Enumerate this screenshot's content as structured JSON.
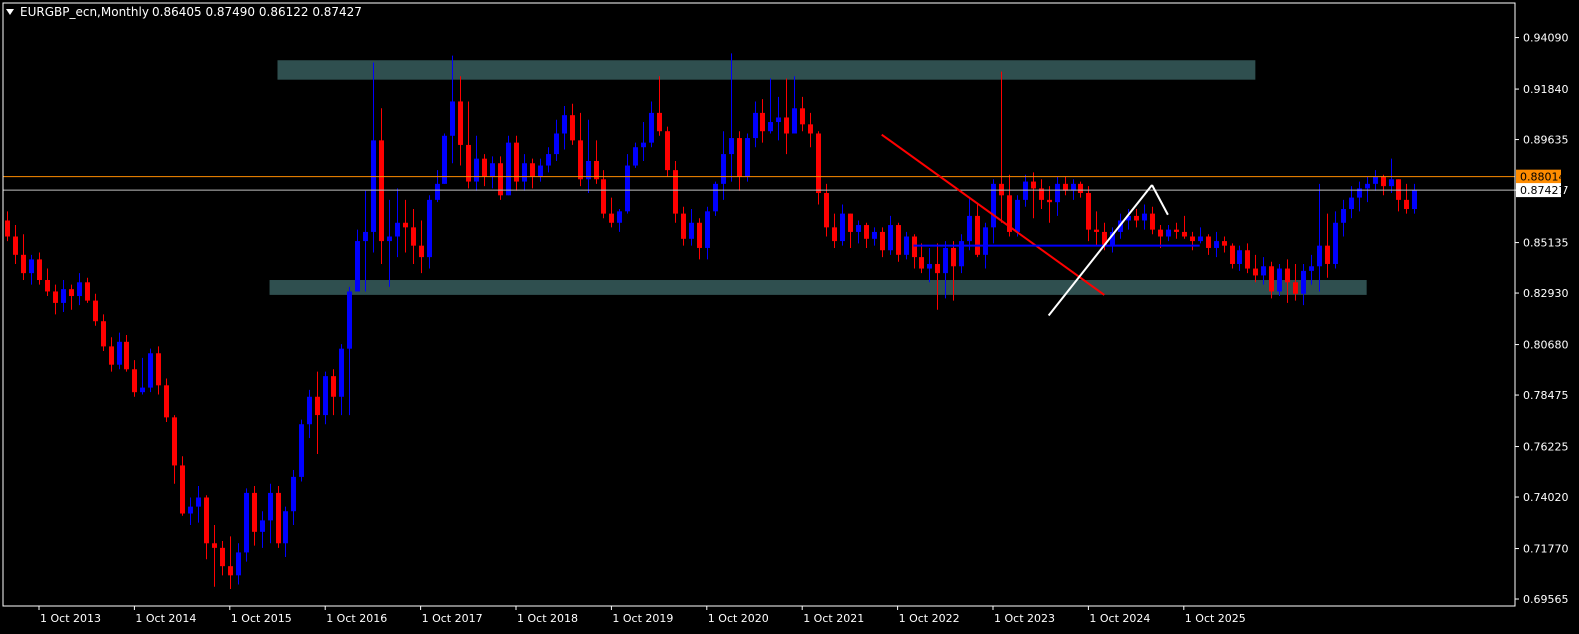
{
  "window": {
    "symbol_title": "EURGBP_ecn,Monthly",
    "ohlc_text": "0.86405 0.87490 0.86122 0.87427",
    "menu_icon": "triangle-down-icon"
  },
  "colors": {
    "background": "#000000",
    "frame": "#ffffff",
    "bull_candle": "#0000ff",
    "bear_candle": "#ff0000",
    "zone_fill": "#2f4f4f",
    "orange_line": "#ff8c00",
    "current_price_line": "#c0c0c0",
    "trendline_red": "#ff0000",
    "support_line_blue": "#0000ff",
    "swing_line_white": "#ffffff"
  },
  "chart_data": {
    "type": "candlestick",
    "timeframe": "Monthly",
    "x_tick_labels": [
      "1 Oct 2013",
      "1 Oct 2014",
      "1 Oct 2015",
      "1 Oct 2016",
      "1 Oct 2017",
      "1 Oct 2018",
      "1 Oct 2019",
      "1 Oct 2020",
      "1 Oct 2021",
      "1 Oct 2022",
      "1 Oct 2023",
      "1 Oct 2024",
      "1 Oct 2025"
    ],
    "y_ticks": [
      0.9409,
      0.9184,
      0.89635,
      0.87427,
      0.85135,
      0.8293,
      0.8068,
      0.78475,
      0.76225,
      0.7402,
      0.7177,
      0.69565
    ],
    "y_tick_labels": [
      "0.94090",
      "0.91840",
      "0.89635",
      "0.87427",
      "0.85135",
      "0.82930",
      "0.80680",
      "0.78475",
      "0.76225",
      "0.74020",
      "0.71770",
      "0.69565"
    ],
    "ylim": [
      0.6926,
      0.956
    ],
    "x_start": "2013-06",
    "candles": [
      [
        0.861,
        0.865,
        0.852,
        0.854
      ],
      [
        0.854,
        0.859,
        0.842,
        0.846
      ],
      [
        0.846,
        0.855,
        0.835,
        0.838
      ],
      [
        0.838,
        0.846,
        0.833,
        0.844
      ],
      [
        0.844,
        0.847,
        0.833,
        0.835
      ],
      [
        0.835,
        0.84,
        0.828,
        0.83
      ],
      [
        0.83,
        0.833,
        0.82,
        0.825
      ],
      [
        0.825,
        0.835,
        0.821,
        0.831
      ],
      [
        0.831,
        0.833,
        0.822,
        0.828
      ],
      [
        0.828,
        0.838,
        0.824,
        0.834
      ],
      [
        0.834,
        0.836,
        0.825,
        0.826
      ],
      [
        0.826,
        0.829,
        0.815,
        0.817
      ],
      [
        0.817,
        0.82,
        0.804,
        0.806
      ],
      [
        0.806,
        0.81,
        0.795,
        0.798
      ],
      [
        0.798,
        0.812,
        0.796,
        0.808
      ],
      [
        0.808,
        0.811,
        0.795,
        0.796
      ],
      [
        0.796,
        0.8,
        0.784,
        0.786
      ],
      [
        0.786,
        0.801,
        0.785,
        0.788
      ],
      [
        0.788,
        0.805,
        0.786,
        0.803
      ],
      [
        0.803,
        0.806,
        0.785,
        0.789
      ],
      [
        0.789,
        0.792,
        0.773,
        0.775
      ],
      [
        0.775,
        0.776,
        0.746,
        0.754
      ],
      [
        0.754,
        0.758,
        0.732,
        0.733
      ],
      [
        0.733,
        0.74,
        0.728,
        0.736
      ],
      [
        0.736,
        0.745,
        0.729,
        0.74
      ],
      [
        0.74,
        0.741,
        0.713,
        0.72
      ],
      [
        0.72,
        0.728,
        0.701,
        0.718
      ],
      [
        0.718,
        0.721,
        0.706,
        0.71
      ],
      [
        0.71,
        0.723,
        0.7,
        0.706
      ],
      [
        0.706,
        0.72,
        0.702,
        0.716
      ],
      [
        0.716,
        0.744,
        0.712,
        0.742
      ],
      [
        0.742,
        0.745,
        0.719,
        0.725
      ],
      [
        0.725,
        0.734,
        0.718,
        0.73
      ],
      [
        0.73,
        0.746,
        0.72,
        0.742
      ],
      [
        0.742,
        0.745,
        0.718,
        0.72
      ],
      [
        0.72,
        0.736,
        0.714,
        0.734
      ],
      [
        0.734,
        0.752,
        0.728,
        0.749
      ],
      [
        0.749,
        0.774,
        0.747,
        0.772
      ],
      [
        0.772,
        0.787,
        0.766,
        0.784
      ],
      [
        0.784,
        0.795,
        0.759,
        0.776
      ],
      [
        0.776,
        0.795,
        0.772,
        0.793
      ],
      [
        0.793,
        0.796,
        0.776,
        0.784
      ],
      [
        0.784,
        0.807,
        0.776,
        0.805
      ],
      [
        0.805,
        0.832,
        0.776,
        0.83
      ],
      [
        0.83,
        0.857,
        0.83,
        0.852
      ],
      [
        0.852,
        0.874,
        0.83,
        0.856
      ],
      [
        0.856,
        0.93,
        0.847,
        0.896
      ],
      [
        0.896,
        0.91,
        0.842,
        0.852
      ],
      [
        0.852,
        0.87,
        0.832,
        0.854
      ],
      [
        0.854,
        0.875,
        0.845,
        0.86
      ],
      [
        0.86,
        0.87,
        0.847,
        0.858
      ],
      [
        0.858,
        0.866,
        0.842,
        0.85
      ],
      [
        0.85,
        0.861,
        0.838,
        0.845
      ],
      [
        0.845,
        0.872,
        0.84,
        0.87
      ],
      [
        0.87,
        0.883,
        0.869,
        0.877
      ],
      [
        0.877,
        0.899,
        0.877,
        0.898
      ],
      [
        0.898,
        0.933,
        0.886,
        0.913
      ],
      [
        0.913,
        0.924,
        0.885,
        0.894
      ],
      [
        0.894,
        0.913,
        0.875,
        0.878
      ],
      [
        0.878,
        0.898,
        0.874,
        0.888
      ],
      [
        0.888,
        0.89,
        0.876,
        0.88
      ],
      [
        0.88,
        0.889,
        0.875,
        0.886
      ],
      [
        0.886,
        0.889,
        0.87,
        0.872
      ],
      [
        0.872,
        0.898,
        0.872,
        0.895
      ],
      [
        0.895,
        0.898,
        0.874,
        0.878
      ],
      [
        0.878,
        0.89,
        0.874,
        0.886
      ],
      [
        0.886,
        0.888,
        0.875,
        0.88
      ],
      [
        0.88,
        0.888,
        0.878,
        0.885
      ],
      [
        0.885,
        0.893,
        0.882,
        0.89
      ],
      [
        0.89,
        0.905,
        0.887,
        0.899
      ],
      [
        0.899,
        0.911,
        0.892,
        0.907
      ],
      [
        0.907,
        0.912,
        0.894,
        0.896
      ],
      [
        0.896,
        0.908,
        0.876,
        0.879
      ],
      [
        0.879,
        0.905,
        0.873,
        0.887
      ],
      [
        0.887,
        0.896,
        0.877,
        0.879
      ],
      [
        0.879,
        0.883,
        0.862,
        0.864
      ],
      [
        0.864,
        0.871,
        0.858,
        0.86
      ],
      [
        0.86,
        0.866,
        0.856,
        0.865
      ],
      [
        0.865,
        0.89,
        0.864,
        0.885
      ],
      [
        0.885,
        0.895,
        0.884,
        0.893
      ],
      [
        0.893,
        0.904,
        0.887,
        0.895
      ],
      [
        0.895,
        0.913,
        0.893,
        0.908
      ],
      [
        0.908,
        0.924,
        0.898,
        0.9
      ],
      [
        0.9,
        0.902,
        0.88,
        0.883
      ],
      [
        0.883,
        0.887,
        0.86,
        0.864
      ],
      [
        0.864,
        0.867,
        0.85,
        0.853
      ],
      [
        0.853,
        0.866,
        0.85,
        0.86
      ],
      [
        0.86,
        0.862,
        0.844,
        0.849
      ],
      [
        0.849,
        0.867,
        0.844,
        0.865
      ],
      [
        0.865,
        0.878,
        0.863,
        0.877
      ],
      [
        0.877,
        0.9,
        0.87,
        0.89
      ],
      [
        0.89,
        0.934,
        0.878,
        0.897
      ],
      [
        0.897,
        0.9,
        0.874,
        0.88
      ],
      [
        0.88,
        0.899,
        0.878,
        0.897
      ],
      [
        0.897,
        0.913,
        0.893,
        0.908
      ],
      [
        0.908,
        0.914,
        0.895,
        0.9
      ],
      [
        0.9,
        0.923,
        0.899,
        0.904
      ],
      [
        0.904,
        0.915,
        0.896,
        0.906
      ],
      [
        0.906,
        0.923,
        0.89,
        0.899
      ],
      [
        0.899,
        0.924,
        0.899,
        0.91
      ],
      [
        0.91,
        0.915,
        0.9,
        0.903
      ],
      [
        0.903,
        0.908,
        0.893,
        0.899
      ],
      [
        0.899,
        0.9,
        0.868,
        0.873
      ],
      [
        0.873,
        0.877,
        0.854,
        0.858
      ],
      [
        0.858,
        0.864,
        0.849,
        0.852
      ],
      [
        0.852,
        0.868,
        0.85,
        0.864
      ],
      [
        0.864,
        0.864,
        0.849,
        0.856
      ],
      [
        0.856,
        0.861,
        0.851,
        0.859
      ],
      [
        0.859,
        0.86,
        0.849,
        0.853
      ],
      [
        0.853,
        0.858,
        0.85,
        0.856
      ],
      [
        0.856,
        0.858,
        0.845,
        0.848
      ],
      [
        0.848,
        0.863,
        0.846,
        0.859
      ],
      [
        0.859,
        0.86,
        0.843,
        0.846
      ],
      [
        0.846,
        0.856,
        0.844,
        0.854
      ],
      [
        0.854,
        0.855,
        0.84,
        0.845
      ],
      [
        0.845,
        0.851,
        0.838,
        0.84
      ],
      [
        0.84,
        0.849,
        0.834,
        0.842
      ],
      [
        0.842,
        0.851,
        0.822,
        0.838
      ],
      [
        0.838,
        0.852,
        0.827,
        0.849
      ],
      [
        0.849,
        0.852,
        0.826,
        0.841
      ],
      [
        0.841,
        0.855,
        0.838,
        0.852
      ],
      [
        0.852,
        0.871,
        0.848,
        0.863
      ],
      [
        0.863,
        0.868,
        0.845,
        0.846
      ],
      [
        0.846,
        0.86,
        0.84,
        0.858
      ],
      [
        0.858,
        0.879,
        0.851,
        0.877
      ],
      [
        0.877,
        0.926,
        0.86,
        0.872
      ],
      [
        0.872,
        0.881,
        0.854,
        0.856
      ],
      [
        0.856,
        0.872,
        0.854,
        0.87
      ],
      [
        0.87,
        0.881,
        0.867,
        0.878
      ],
      [
        0.878,
        0.882,
        0.862,
        0.875
      ],
      [
        0.875,
        0.879,
        0.866,
        0.87
      ],
      [
        0.87,
        0.876,
        0.86,
        0.869
      ],
      [
        0.869,
        0.88,
        0.863,
        0.877
      ],
      [
        0.877,
        0.88,
        0.872,
        0.874
      ],
      [
        0.874,
        0.879,
        0.87,
        0.877
      ],
      [
        0.877,
        0.878,
        0.871,
        0.873
      ],
      [
        0.873,
        0.876,
        0.852,
        0.857
      ],
      [
        0.857,
        0.865,
        0.85,
        0.856
      ],
      [
        0.856,
        0.86,
        0.848,
        0.85
      ],
      [
        0.85,
        0.858,
        0.847,
        0.856
      ],
      [
        0.856,
        0.864,
        0.853,
        0.861
      ],
      [
        0.861,
        0.866,
        0.857,
        0.863
      ],
      [
        0.863,
        0.866,
        0.858,
        0.861
      ],
      [
        0.861,
        0.868,
        0.857,
        0.864
      ],
      [
        0.864,
        0.867,
        0.855,
        0.857
      ],
      [
        0.857,
        0.859,
        0.849,
        0.854
      ],
      [
        0.854,
        0.859,
        0.852,
        0.857
      ],
      [
        0.857,
        0.86,
        0.853,
        0.856
      ],
      [
        0.856,
        0.863,
        0.853,
        0.854
      ],
      [
        0.854,
        0.856,
        0.848,
        0.852
      ],
      [
        0.852,
        0.858,
        0.851,
        0.854
      ],
      [
        0.854,
        0.855,
        0.846,
        0.849
      ],
      [
        0.849,
        0.856,
        0.845,
        0.852
      ],
      [
        0.852,
        0.854,
        0.847,
        0.85
      ],
      [
        0.85,
        0.851,
        0.84,
        0.842
      ],
      [
        0.842,
        0.85,
        0.839,
        0.848
      ],
      [
        0.848,
        0.851,
        0.838,
        0.84
      ],
      [
        0.84,
        0.846,
        0.834,
        0.837
      ],
      [
        0.837,
        0.845,
        0.833,
        0.841
      ],
      [
        0.841,
        0.843,
        0.827,
        0.83
      ],
      [
        0.83,
        0.842,
        0.828,
        0.84
      ],
      [
        0.84,
        0.844,
        0.825,
        0.834
      ],
      [
        0.834,
        0.842,
        0.826,
        0.829
      ],
      [
        0.829,
        0.842,
        0.824,
        0.839
      ],
      [
        0.839,
        0.846,
        0.833,
        0.841
      ],
      [
        0.841,
        0.877,
        0.83,
        0.85
      ],
      [
        0.85,
        0.864,
        0.836,
        0.842
      ],
      [
        0.842,
        0.865,
        0.84,
        0.86
      ],
      [
        0.86,
        0.87,
        0.854,
        0.866
      ],
      [
        0.866,
        0.876,
        0.862,
        0.871
      ],
      [
        0.871,
        0.878,
        0.865,
        0.875
      ],
      [
        0.875,
        0.88,
        0.869,
        0.877
      ],
      [
        0.877,
        0.883,
        0.874,
        0.88
      ],
      [
        0.88,
        0.881,
        0.872,
        0.876
      ],
      [
        0.876,
        0.888,
        0.873,
        0.879
      ],
      [
        0.879,
        0.879,
        0.865,
        0.87
      ],
      [
        0.87,
        0.877,
        0.864,
        0.866
      ],
      [
        0.866,
        0.877,
        0.864,
        0.8743
      ]
    ],
    "zones": [
      {
        "label": "",
        "y_top": 0.931,
        "y_bottom": 0.9225,
        "x_from": "2016-04",
        "x_to": "2026-07"
      },
      {
        "label": "",
        "y_top": 0.835,
        "y_bottom": 0.8285,
        "x_from": "2016-03",
        "x_to": "2027-09"
      }
    ],
    "hlines": [
      {
        "kind": "orange-level",
        "y": 0.88014,
        "label": "0.88014"
      },
      {
        "kind": "current-price",
        "y": 0.87427,
        "label": "0.87427"
      }
    ],
    "lines": [
      {
        "kind": "red-trendline",
        "from": [
          "2022-08",
          0.8985
        ],
        "to": [
          "2024-12",
          0.8285
        ]
      },
      {
        "kind": "blue-support",
        "from": [
          "2022-12",
          0.85
        ],
        "to": [
          "2025-12",
          0.85
        ]
      },
      {
        "kind": "white-up-swing",
        "from": [
          "2024-05",
          0.8195
        ],
        "to": [
          "2025-06",
          0.8765
        ]
      },
      {
        "kind": "white-down-swing",
        "from": [
          "2025-06",
          0.8765
        ],
        "to": [
          "2025-08",
          0.8635
        ]
      }
    ]
  }
}
